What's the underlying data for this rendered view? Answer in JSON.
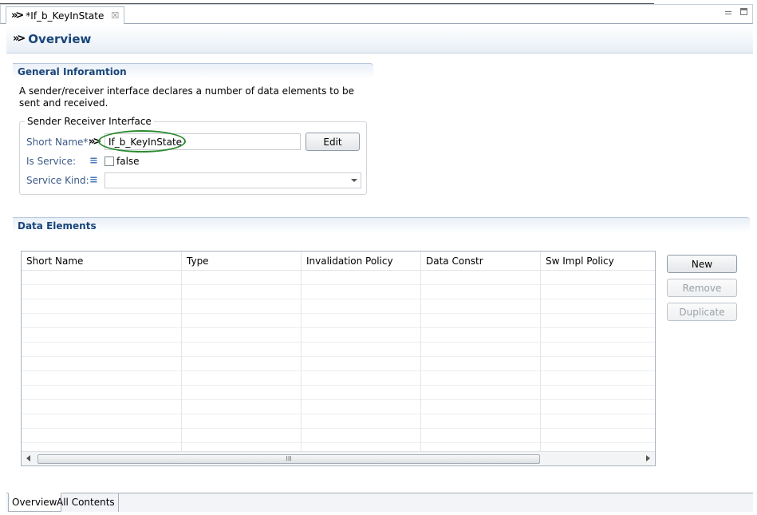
{
  "editor_tab": {
    "title": "*If_b_KeyInState",
    "close_symbol": "☒"
  },
  "form": {
    "title": "Overview"
  },
  "general": {
    "title": "General Inforamtion",
    "description": "A sender/receiver interface declares a number of data elements to be sent and received.",
    "group_label": "Sender Receiver Interface",
    "short_name_label": "Short Name*:",
    "short_name_value": "If_b_KeyInState",
    "edit_label": "Edit",
    "is_service_label": "Is Service:",
    "is_service_value": "false",
    "service_kind_label": "Service Kind:",
    "service_kind_value": ""
  },
  "data_elements": {
    "title": "Data Elements",
    "columns": [
      "Short Name",
      "Type",
      "Invalidation Policy",
      "Data Constr",
      "Sw Impl Policy"
    ],
    "rows": [],
    "buttons": {
      "new": "New",
      "remove": "Remove",
      "duplicate": "Duplicate"
    },
    "scroll_thumb_grip": "III"
  },
  "bottom_tabs": [
    "Overview",
    "All Contents"
  ],
  "colors": {
    "section_title": "#19457a",
    "label": "#3b5a88",
    "highlight_oval": "#2b8a2f"
  }
}
